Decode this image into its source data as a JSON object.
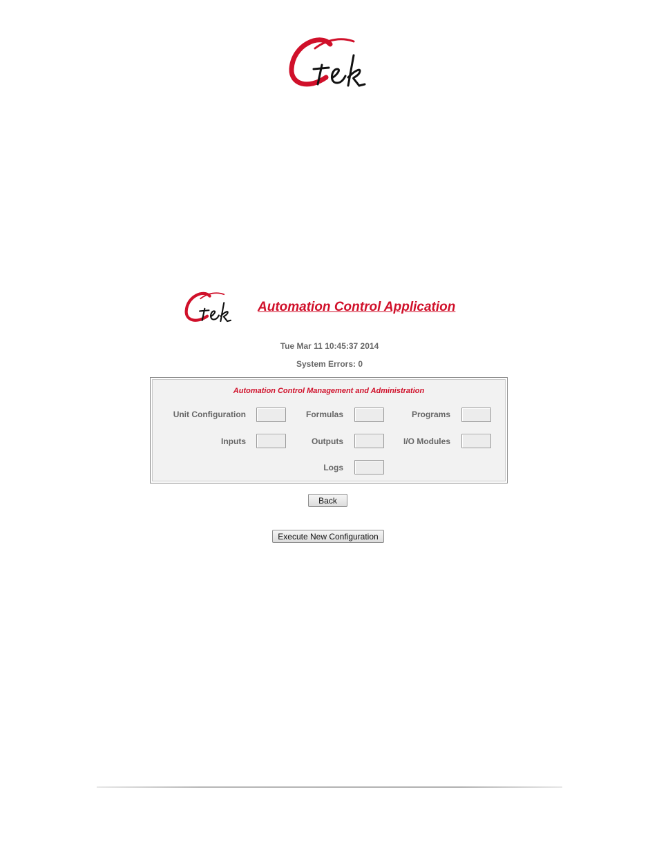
{
  "logo": {
    "text": "Ctek",
    "color": "#d0102a"
  },
  "header": {
    "title": "Automation Control Application"
  },
  "status": {
    "timestamp": "Tue Mar 11 10:45:37 2014",
    "errors": "System Errors: 0"
  },
  "panel": {
    "title": "Automation Control Management and Administration",
    "items": [
      {
        "label": "Unit Configuration"
      },
      {
        "label": "Formulas"
      },
      {
        "label": "Programs"
      },
      {
        "label": "Inputs"
      },
      {
        "label": "Outputs"
      },
      {
        "label": "I/O Modules"
      },
      {
        "label": "Logs"
      }
    ]
  },
  "buttons": {
    "back": "Back",
    "execute": "Execute New Configuration"
  },
  "colors": {
    "accent": "#d0102a",
    "panel_bg": "#f2f2f2",
    "label": "#666666"
  }
}
